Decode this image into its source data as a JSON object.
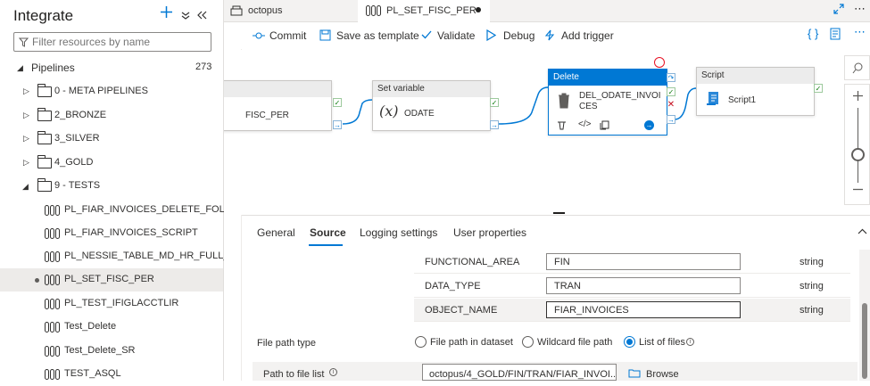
{
  "left_panel": {
    "title": "Integrate",
    "filter_placeholder": "Filter resources by name",
    "section": {
      "label": "Pipelines",
      "count": "273"
    },
    "items": [
      {
        "kind": "folder",
        "label": "0 - META PIPELINES",
        "expanded": false
      },
      {
        "kind": "folder",
        "label": "2_BRONZE",
        "expanded": false
      },
      {
        "kind": "folder",
        "label": "3_SILVER",
        "expanded": false
      },
      {
        "kind": "folder",
        "label": "4_GOLD",
        "expanded": false
      },
      {
        "kind": "folder",
        "label": "9 - TESTS",
        "expanded": true
      },
      {
        "kind": "pipeline",
        "label": "PL_FIAR_INVOICES_DELETE_FOLD..."
      },
      {
        "kind": "pipeline",
        "label": "PL_FIAR_INVOICES_SCRIPT"
      },
      {
        "kind": "pipeline",
        "label": "PL_NESSIE_TABLE_MD_HR_FULL_..."
      },
      {
        "kind": "pipeline",
        "label": "PL_SET_FISC_PER",
        "selected": true
      },
      {
        "kind": "pipeline",
        "label": "PL_TEST_IFIGLACCTLIR"
      },
      {
        "kind": "pipeline",
        "label": "Test_Delete"
      },
      {
        "kind": "pipeline",
        "label": "Test_Delete_SR"
      },
      {
        "kind": "pipeline",
        "label": "TEST_ASQL"
      }
    ]
  },
  "tabs": [
    {
      "label": "octopus",
      "active": false
    },
    {
      "label": "PL_SET_FISC_PER",
      "active": true,
      "modified": true
    }
  ],
  "toolbar": {
    "commit": "Commit",
    "save_template": "Save as template",
    "validate": "Validate",
    "debug": "Debug",
    "add_trigger": "Add trigger"
  },
  "canvas": {
    "activities": [
      {
        "name": "partial",
        "title": "",
        "label": "FISC_PER"
      },
      {
        "name": "set-variable",
        "title": "Set variable",
        "label": "ODATE",
        "icon": "variable-icon"
      },
      {
        "name": "delete",
        "title": "Delete",
        "label": "DEL_ODATE_INVOICES",
        "label_lines": [
          "DEL_ODATE_INVOI",
          "CES"
        ],
        "selected": true,
        "icon": "trash-icon"
      },
      {
        "name": "script",
        "title": "Script",
        "label": "Script1",
        "icon": "script-icon"
      }
    ]
  },
  "bottom_tabs": [
    "General",
    "Source",
    "Logging settings",
    "User properties"
  ],
  "active_bottom_tab": "Source",
  "params": [
    {
      "name": "FUNCTIONAL_AREA",
      "value": "FIN",
      "type": "string"
    },
    {
      "name": "DATA_TYPE",
      "value": "TRAN",
      "type": "string"
    },
    {
      "name": "OBJECT_NAME",
      "value": "FIAR_INVOICES",
      "type": "string"
    }
  ],
  "file_path_type": {
    "label": "File path type",
    "options": [
      "File path in dataset",
      "Wildcard file path",
      "List of files"
    ],
    "selected": "List of files"
  },
  "path_to_file_list": {
    "label": "Path to file list",
    "value": "octopus/4_GOLD/FIN/TRAN/FIAR_INVOI...",
    "browse": "Browse"
  },
  "colors": {
    "accent": "#0078d4",
    "success": "#107c10",
    "error": "#c50f1f"
  }
}
